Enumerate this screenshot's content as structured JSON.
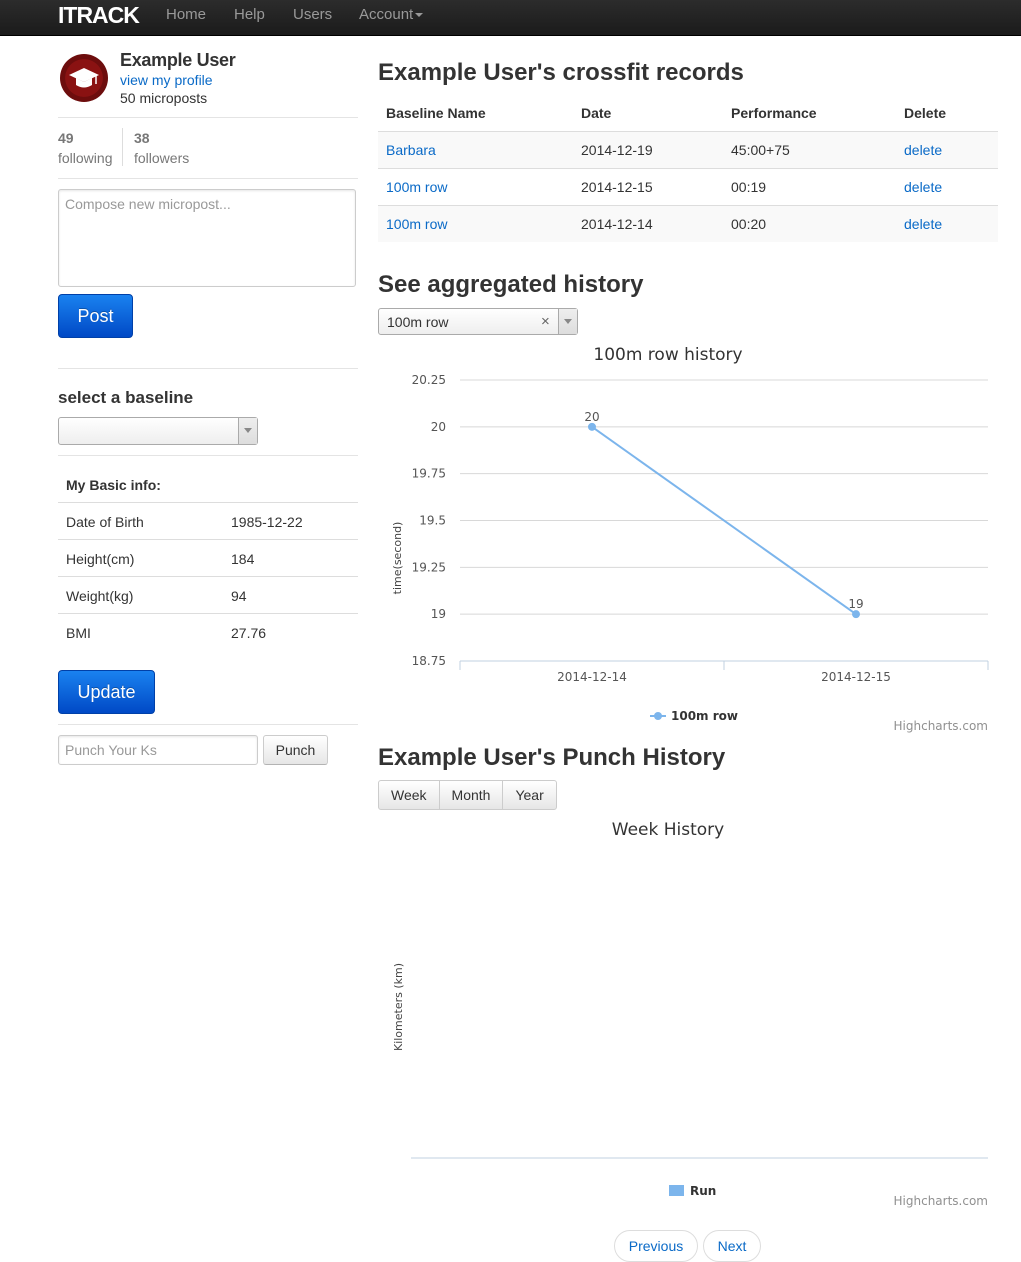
{
  "navbar": {
    "brand": "ITRACK",
    "items": [
      "Home",
      "Help",
      "Users"
    ],
    "account": "Account"
  },
  "profile": {
    "name": "Example User",
    "view_profile": "view my profile",
    "microposts": "50 microposts",
    "following_count": "49",
    "following_label": "following",
    "followers_count": "38",
    "followers_label": "followers"
  },
  "compose": {
    "placeholder": "Compose new micropost...",
    "post_button": "Post"
  },
  "baseline": {
    "heading": "select a baseline",
    "selected": ""
  },
  "basic_info": {
    "heading": "My Basic info:",
    "rows": [
      {
        "label": "Date of Birth",
        "value": "1985-12-22"
      },
      {
        "label": "Height(cm)",
        "value": "184"
      },
      {
        "label": "Weight(kg)",
        "value": "94"
      },
      {
        "label": "BMI",
        "value": "27.76"
      }
    ],
    "update_button": "Update"
  },
  "punch": {
    "placeholder": "Punch Your Ks",
    "button": "Punch"
  },
  "records": {
    "heading": "Example User's crossfit records",
    "columns": [
      "Baseline Name",
      "Date",
      "Performance",
      "Delete"
    ],
    "rows": [
      {
        "name": "Barbara",
        "date": "2014-12-19",
        "performance": "45:00+75",
        "delete": "delete"
      },
      {
        "name": "100m row",
        "date": "2014-12-15",
        "performance": "00:19",
        "delete": "delete"
      },
      {
        "name": "100m row",
        "date": "2014-12-14",
        "performance": "00:20",
        "delete": "delete"
      }
    ]
  },
  "aggregated": {
    "heading": "See aggregated history",
    "selected": "100m row",
    "clear_icon": "×"
  },
  "punch_history": {
    "heading": "Example User's Punch History",
    "tabs": [
      "Week",
      "Month",
      "Year"
    ]
  },
  "pager": {
    "previous": "Previous",
    "next": "Next"
  },
  "colors": {
    "series": "#7cb5ec",
    "link": "#0a6ac7",
    "primary": "#0049c6"
  },
  "chart_data": [
    {
      "type": "line",
      "title": "100m row history",
      "ylabel": "time(second)",
      "xlabel": "",
      "categories": [
        "2014-12-14",
        "2014-12-15"
      ],
      "series": [
        {
          "name": "100m row",
          "values": [
            20,
            19
          ]
        }
      ],
      "ylim": [
        18.75,
        20.25
      ],
      "yticks": [
        "20.25",
        "20",
        "19.75",
        "19.5",
        "19.25",
        "19",
        "18.75"
      ],
      "data_labels": [
        "20",
        "19"
      ],
      "credits": "Highcharts.com",
      "grid": true,
      "legend_position": "bottom-center"
    },
    {
      "type": "bar",
      "title": "Week History",
      "ylabel": "Kilometers (km)",
      "categories": [],
      "series": [
        {
          "name": "Run",
          "values": []
        }
      ],
      "credits": "Highcharts.com",
      "legend_position": "bottom-center"
    }
  ]
}
